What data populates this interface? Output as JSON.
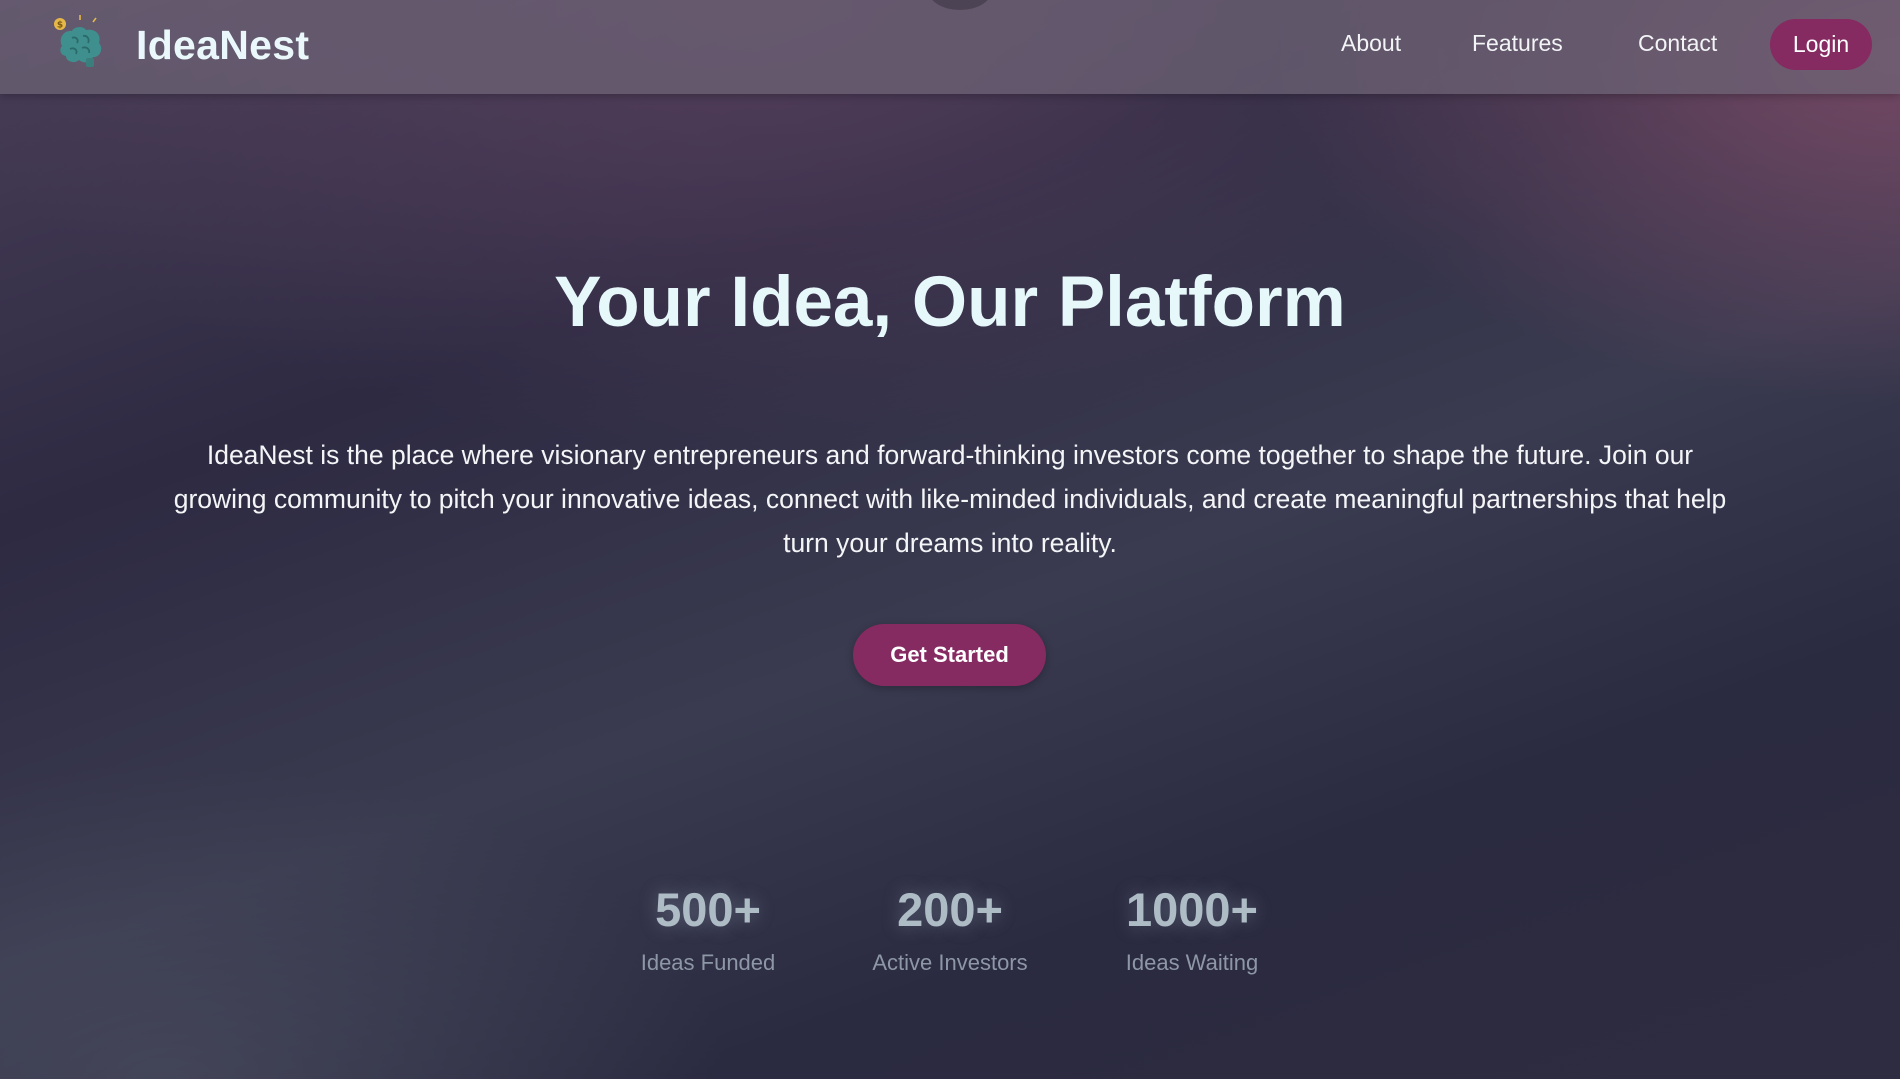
{
  "header": {
    "brand": "IdeaNest",
    "logo_icon": "brain-lightbulb-icon",
    "nav": {
      "about": "About",
      "features": "Features",
      "contact": "Contact",
      "login": "Login"
    }
  },
  "hero": {
    "title": "Your Idea, Our Platform",
    "description": "IdeaNest is the place where visionary entrepreneurs and forward-thinking investors come together to shape the future. Join our growing community to pitch your innovative ideas, connect with like-minded individuals, and create meaningful partnerships that help turn your dreams into reality.",
    "cta_label": "Get Started"
  },
  "stats": [
    {
      "value": "500+",
      "label": "Ideas Funded"
    },
    {
      "value": "200+",
      "label": "Active Investors"
    },
    {
      "value": "1000+",
      "label": "Ideas Waiting"
    }
  ],
  "colors": {
    "accent": "#862a62",
    "title": "#e6f8fa",
    "stat_value": "#aebcc6",
    "stat_label": "#8e97a6"
  }
}
